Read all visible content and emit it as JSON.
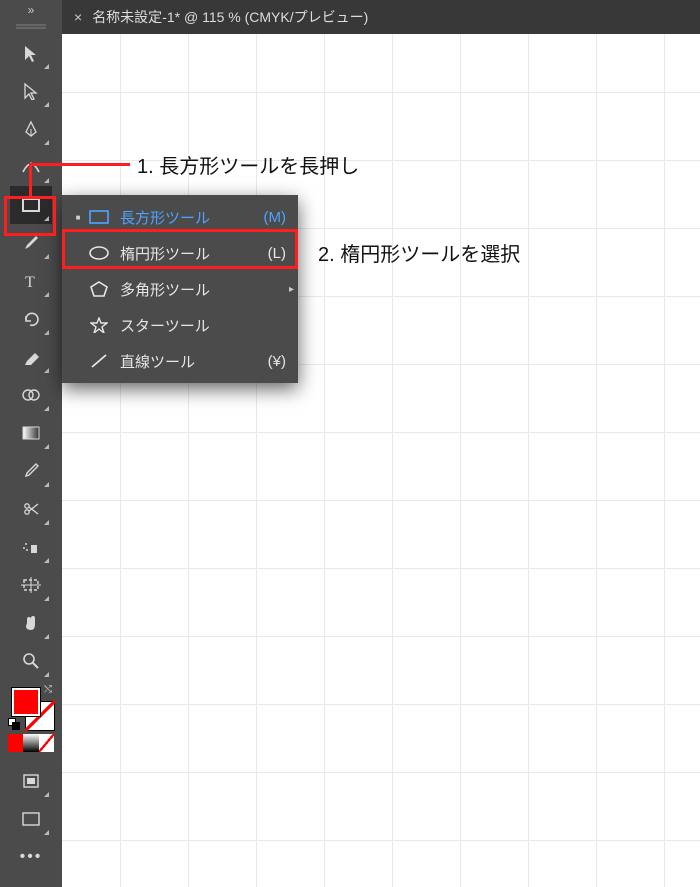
{
  "tab": {
    "title": "名称未設定-1* @ 115 % (CMYK/プレビュー)",
    "close": "×"
  },
  "tool_expand": "»",
  "flyout": {
    "items": [
      {
        "label": "長方形ツール",
        "shortcut": "(M)",
        "icon": "rectangle",
        "current": true,
        "chevron": false
      },
      {
        "label": "楕円形ツール",
        "shortcut": "(L)",
        "icon": "ellipse",
        "current": false,
        "chevron": false
      },
      {
        "label": "多角形ツール",
        "shortcut": "",
        "icon": "polygon",
        "current": false,
        "chevron": true
      },
      {
        "label": "スターツール",
        "shortcut": "",
        "icon": "star",
        "current": false,
        "chevron": false
      },
      {
        "label": "直線ツール",
        "shortcut": "(¥)",
        "icon": "line",
        "current": false,
        "chevron": false
      }
    ]
  },
  "annotations": {
    "a1": "1. 長方形ツールを長押し",
    "a2": "2. 楕円形ツールを選択"
  },
  "swatch": {
    "fill": "#ff0000",
    "stroke": "none"
  }
}
